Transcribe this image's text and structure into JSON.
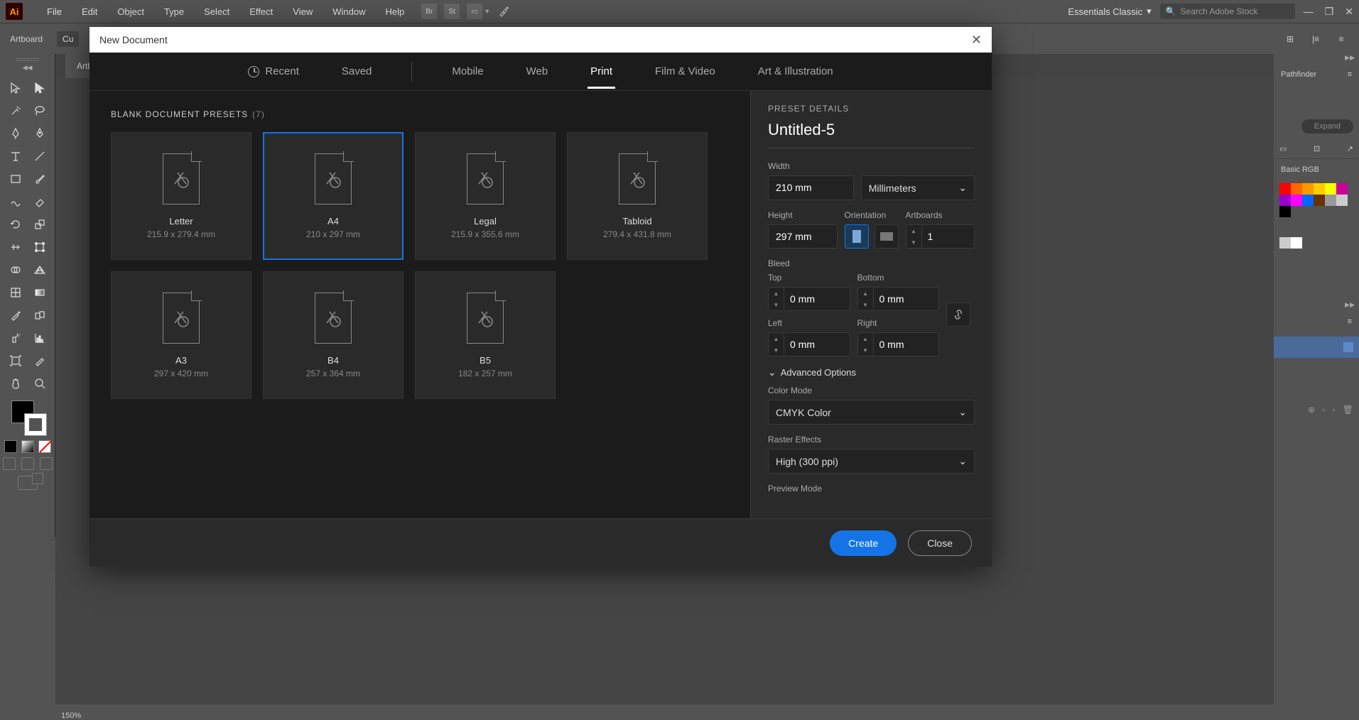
{
  "app": {
    "logo": "Ai"
  },
  "menu": [
    "File",
    "Edit",
    "Object",
    "Type",
    "Select",
    "Effect",
    "View",
    "Window",
    "Help"
  ],
  "workspace": "Essentials Classic",
  "search_placeholder": "Search Adobe Stock",
  "control_bar": {
    "label": "Artboard",
    "cu_prefix": "Cu"
  },
  "doc_tab": "Artbo",
  "zoom": "150%",
  "right_panel": {
    "pathfinder": "Pathfinder",
    "expand": "Expand",
    "basic_rgb": "Basic RGB"
  },
  "modal": {
    "title": "New Document",
    "tabs": [
      "Recent",
      "Saved",
      "Mobile",
      "Web",
      "Print",
      "Film & Video",
      "Art & Illustration"
    ],
    "active_tab": "Print",
    "presets_title": "BLANK DOCUMENT PRESETS",
    "presets_count": "(7)",
    "presets": [
      {
        "name": "Letter",
        "dim": "215.9 x 279.4 mm",
        "selected": false
      },
      {
        "name": "A4",
        "dim": "210 x 297 mm",
        "selected": true
      },
      {
        "name": "Legal",
        "dim": "215.9 x 355.6 mm",
        "selected": false
      },
      {
        "name": "Tabloid",
        "dim": "279.4 x 431.8 mm",
        "selected": false
      },
      {
        "name": "A3",
        "dim": "297 x 420 mm",
        "selected": false
      },
      {
        "name": "B4",
        "dim": "257 x 364 mm",
        "selected": false
      },
      {
        "name": "B5",
        "dim": "182 x 257 mm",
        "selected": false
      }
    ],
    "details": {
      "header": "PRESET DETAILS",
      "name": "Untitled-5",
      "width_label": "Width",
      "width": "210 mm",
      "units": "Millimeters",
      "height_label": "Height",
      "height": "297 mm",
      "orientation_label": "Orientation",
      "artboards_label": "Artboards",
      "artboards": "1",
      "bleed_label": "Bleed",
      "top_label": "Top",
      "top": "0 mm",
      "bottom_label": "Bottom",
      "bottom": "0 mm",
      "left_label": "Left",
      "left": "0 mm",
      "right_label": "Right",
      "right": "0 mm",
      "advanced": "Advanced Options",
      "color_mode_label": "Color Mode",
      "color_mode": "CMYK Color",
      "raster_label": "Raster Effects",
      "raster": "High (300 ppi)",
      "preview_label": "Preview Mode"
    },
    "create": "Create",
    "close": "Close"
  }
}
